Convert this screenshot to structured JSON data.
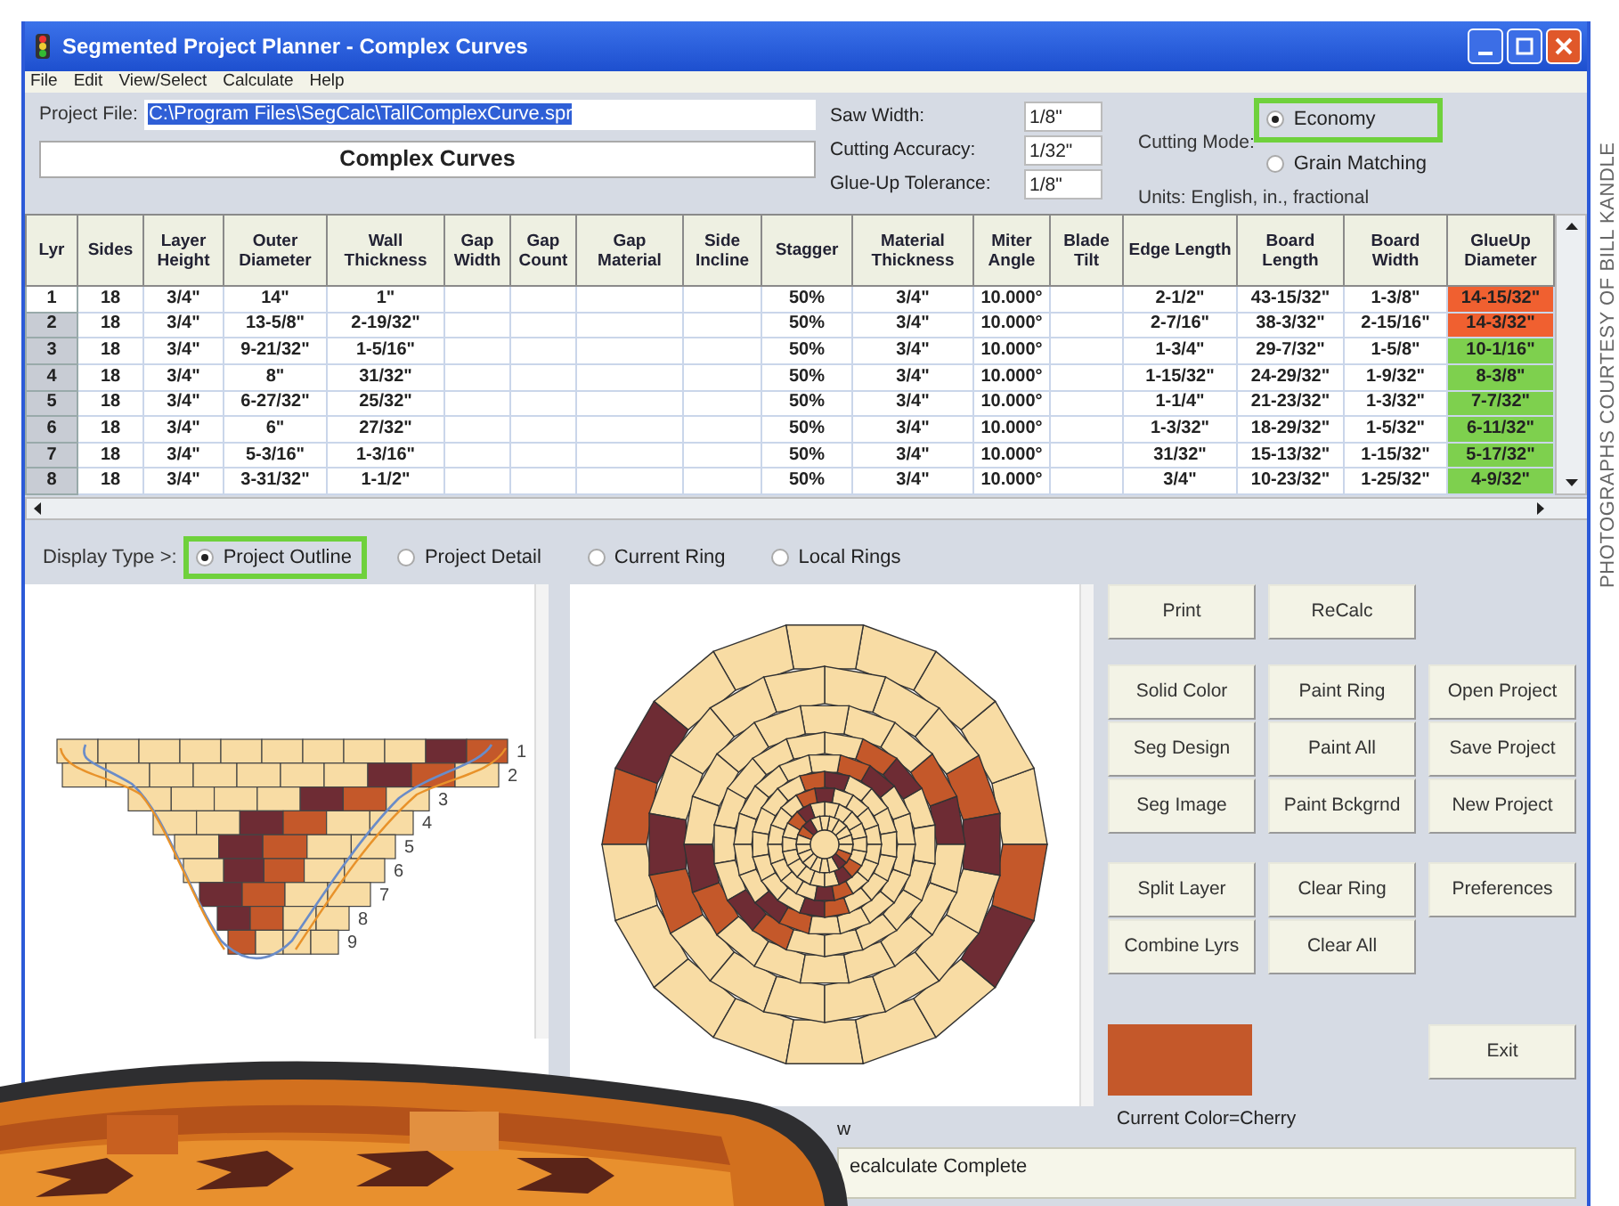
{
  "window": {
    "title": "Segmented Project Planner - Complex Curves"
  },
  "menu": [
    "File",
    "Edit",
    "View/Select",
    "Calculate",
    "Help"
  ],
  "project": {
    "label": "Project File:",
    "file": "C:\\Program Files\\SegCalc\\TallComplexCurve.spr",
    "title": "Complex Curves"
  },
  "settings": [
    {
      "label": "Saw Width:",
      "value": "1/8\""
    },
    {
      "label": "Cutting Accuracy:",
      "value": "1/32\""
    },
    {
      "label": "Glue-Up Tolerance:",
      "value": "1/8\""
    }
  ],
  "cutting_mode": {
    "label": "Cutting Mode:",
    "options": [
      {
        "label": "Economy",
        "selected": true
      },
      {
        "label": "Grain Matching",
        "selected": false
      }
    ]
  },
  "units": "Units: English, in., fractional",
  "table": {
    "columns": [
      "Lyr",
      "Sides",
      "Layer Height",
      "Outer Diameter",
      "Wall Thickness",
      "Gap Width",
      "Gap Count",
      "Gap Material",
      "Side Incline",
      "Stagger",
      "Material Thickness",
      "Miter Angle",
      "Blade Tilt",
      "Edge Length",
      "Board Length",
      "Board Width",
      "GlueUp Diameter"
    ],
    "rows": [
      {
        "selected": true,
        "color": "#f06030",
        "cells": [
          "1",
          "18",
          "3/4\"",
          "14\"",
          "1\"",
          null,
          null,
          null,
          null,
          "50%",
          "3/4\"",
          "10.000°",
          null,
          "2-1/2\"",
          "43-15/32\"",
          "1-3/8\"",
          "14-15/32\""
        ]
      },
      {
        "selected": false,
        "color": "#f06030",
        "cells": [
          "2",
          "18",
          "3/4\"",
          "13-5/8\"",
          "2-19/32\"",
          null,
          null,
          null,
          null,
          "50%",
          "3/4\"",
          "10.000°",
          null,
          "2-7/16\"",
          "38-3/32\"",
          "2-15/16\"",
          "14-3/32\""
        ]
      },
      {
        "selected": false,
        "color": "#7ed04e",
        "cells": [
          "3",
          "18",
          "3/4\"",
          "9-21/32\"",
          "1-5/16\"",
          null,
          null,
          null,
          null,
          "50%",
          "3/4\"",
          "10.000°",
          null,
          "1-3/4\"",
          "29-7/32\"",
          "1-5/8\"",
          "10-1/16\""
        ]
      },
      {
        "selected": false,
        "color": "#7ed04e",
        "cells": [
          "4",
          "18",
          "3/4\"",
          "8\"",
          "31/32\"",
          null,
          null,
          null,
          null,
          "50%",
          "3/4\"",
          "10.000°",
          null,
          "1-15/32\"",
          "24-29/32\"",
          "1-9/32\"",
          "8-3/8\""
        ]
      },
      {
        "selected": false,
        "color": "#7ed04e",
        "cells": [
          "5",
          "18",
          "3/4\"",
          "6-27/32\"",
          "25/32\"",
          null,
          null,
          null,
          null,
          "50%",
          "3/4\"",
          "10.000°",
          null,
          "1-1/4\"",
          "21-23/32\"",
          "1-3/32\"",
          "7-7/32\""
        ]
      },
      {
        "selected": false,
        "color": "#7ed04e",
        "cells": [
          "6",
          "18",
          "3/4\"",
          "6\"",
          "27/32\"",
          null,
          null,
          null,
          null,
          "50%",
          "3/4\"",
          "10.000°",
          null,
          "1-3/32\"",
          "18-29/32\"",
          "1-5/32\"",
          "6-11/32\""
        ]
      },
      {
        "selected": false,
        "color": "#7ed04e",
        "cells": [
          "7",
          "18",
          "3/4\"",
          "5-3/16\"",
          "1-3/16\"",
          null,
          null,
          null,
          null,
          "50%",
          "3/4\"",
          "10.000°",
          null,
          "31/32\"",
          "15-13/32\"",
          "1-15/32\"",
          "5-17/32\""
        ]
      },
      {
        "selected": false,
        "color": "#7ed04e",
        "cells": [
          "8",
          "18",
          "3/4\"",
          "3-31/32\"",
          "1-1/2\"",
          null,
          null,
          null,
          null,
          "50%",
          "3/4\"",
          "10.000°",
          null,
          "3/4\"",
          "10-23/32\"",
          "1-25/32\"",
          "4-9/32\""
        ]
      }
    ]
  },
  "display_type": {
    "label": "Display Type >:",
    "options": [
      {
        "label": "Project Outline",
        "selected": true
      },
      {
        "label": "Project Detail",
        "selected": false
      },
      {
        "label": "Current Ring",
        "selected": false
      },
      {
        "label": "Local Rings",
        "selected": false
      }
    ]
  },
  "profile": {
    "layer_labels": [
      "1",
      "2",
      "3",
      "4",
      "5",
      "6",
      "7",
      "8",
      "9"
    ]
  },
  "ring_panel_label": "w",
  "buttons": [
    [
      "Print",
      "ReCalc"
    ],
    [
      "Solid Color",
      "Paint Ring",
      "Open Project",
      "Seg Design",
      "Paint All",
      "Save Project",
      "Seg Image",
      "Paint Bckgrnd",
      "New Project"
    ],
    [
      "Split Layer",
      "Clear Ring",
      "Preferences",
      "Combine Lyrs",
      "Clear All"
    ]
  ],
  "current_color": {
    "color": "#c4582a",
    "caption": "Current Color=Cherry"
  },
  "exit_button": "Exit",
  "status": "ecalculate Complete",
  "credit": "PHOTOGRAPHS COURTESY OF BILL KANDLE"
}
